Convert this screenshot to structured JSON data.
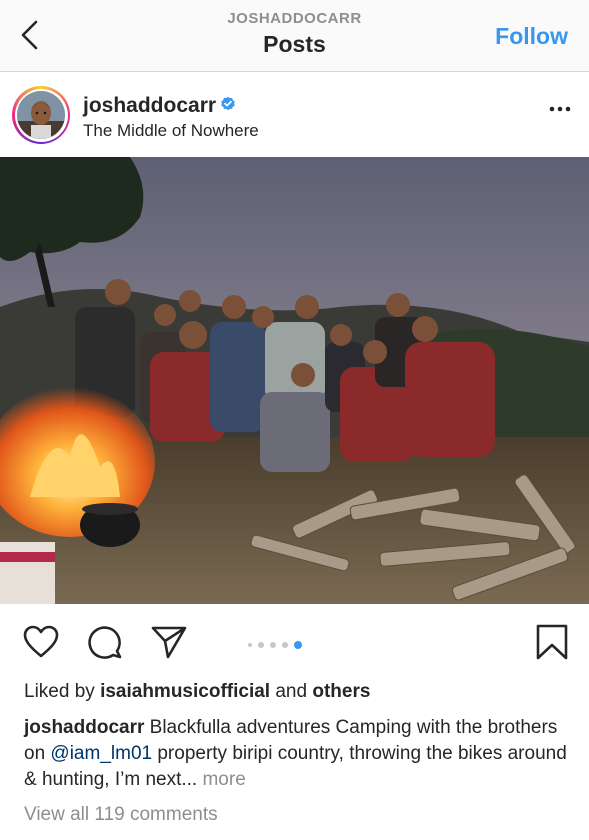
{
  "header": {
    "account": "JOSHADDOCARR",
    "title": "Posts",
    "follow_label": "Follow"
  },
  "post": {
    "username": "joshaddocarr",
    "verified": true,
    "location": "The Middle of Nowhere",
    "photo_description": "campfire group photo",
    "carousel": {
      "count": 5,
      "active_index": 4
    },
    "likes": {
      "prefix": "Liked by",
      "user": "isaiahmusicofficial",
      "joiner": "and",
      "others": "others"
    },
    "caption": {
      "username": "joshaddocarr",
      "text_before": "Blackfulla adventures Camping with the brothers on",
      "mention": "@iam_lm01",
      "text_after": "property biripi country, throwing the bikes around & hunting, I’m next...",
      "more_label": "more"
    },
    "comments_label": "View all 119 comments"
  },
  "icons": {
    "back": "chevron-left-icon",
    "verified": "verified-badge-icon",
    "more": "more-horizontal-icon",
    "like": "heart-icon",
    "comment": "comment-bubble-icon",
    "share": "paper-plane-icon",
    "save": "bookmark-icon"
  },
  "colors": {
    "accent": "#3897f0",
    "mention": "#003569",
    "muted": "#8e8e8e"
  }
}
